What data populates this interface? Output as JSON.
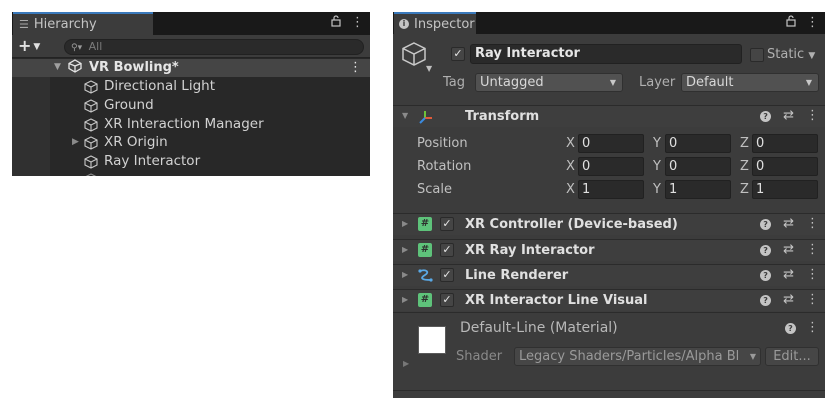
{
  "hierarchy": {
    "tab_label": "Hierarchy",
    "lock_icon": "lock-icon",
    "menu_label": "⋮",
    "add_label": "+",
    "search_placeholder": "All",
    "scene": {
      "name": "VR Bowling*",
      "menu_label": "⋮"
    },
    "items": [
      {
        "name": "Directional Light",
        "foldable": false
      },
      {
        "name": "Ground",
        "foldable": false
      },
      {
        "name": "XR Interaction Manager",
        "foldable": false
      },
      {
        "name": "XR Origin",
        "foldable": true
      },
      {
        "name": "Ray Interactor",
        "foldable": false
      }
    ]
  },
  "inspector": {
    "tab_label": "Inspector",
    "menu_label": "⋮",
    "gameobject": {
      "name": "Ray Interactor",
      "active": true,
      "static_label": "Static",
      "tag_label": "Tag",
      "tag_value": "Untagged",
      "layer_label": "Layer",
      "layer_value": "Default"
    },
    "transform": {
      "title": "Transform",
      "rows": [
        {
          "label": "Position",
          "x": "0",
          "y": "0",
          "z": "0"
        },
        {
          "label": "Rotation",
          "x": "0",
          "y": "0",
          "z": "0"
        },
        {
          "label": "Scale",
          "x": "1",
          "y": "1",
          "z": "1"
        }
      ],
      "axes": {
        "x": "X",
        "y": "Y",
        "z": "Z"
      }
    },
    "components": [
      {
        "title": "XR Controller (Device-based)",
        "icon": "script-icon",
        "enabled": true
      },
      {
        "title": "XR Ray Interactor",
        "icon": "script-icon",
        "enabled": true
      },
      {
        "title": "Line Renderer",
        "icon": "line-renderer-icon",
        "enabled": true
      },
      {
        "title": "XR Interactor Line Visual",
        "icon": "script-icon",
        "enabled": true
      }
    ],
    "material": {
      "title": "Default-Line (Material)",
      "shader_label": "Shader",
      "shader_value": "Legacy Shaders/Particles/Alpha Bl",
      "edit_label": "Edit...",
      "swatch_color": "#ffffff"
    }
  },
  "colors": {
    "tab_accent": "#3a79bb",
    "script_icon": "#5ec27a",
    "panel_bg": "#3c3c3c"
  }
}
